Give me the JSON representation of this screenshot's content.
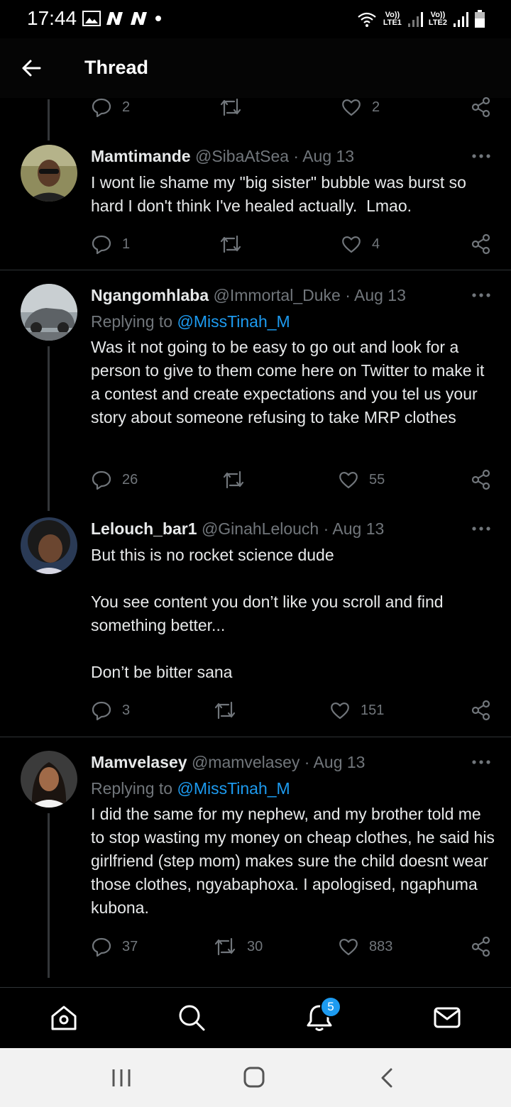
{
  "status_bar": {
    "time": "17:44",
    "lte1": "LTE1",
    "lte2": "LTE2",
    "volte1": "Vo))",
    "volte2": "Vo))"
  },
  "header": {
    "title": "Thread"
  },
  "top_tweet_actions": {
    "replies": "2",
    "retweets": "",
    "likes": "2"
  },
  "tweets": [
    {
      "name": "Mamtimande",
      "handle": "@SibaAtSea",
      "date": "· Aug 13",
      "replying_label": "",
      "replying_to": "",
      "text": "I wont lie shame my \"big sister\" bubble was burst so hard I don't think I've healed actually.  Lmao.",
      "replies": "1",
      "retweets": "",
      "likes": "4"
    },
    {
      "name": "Ngangomhlaba",
      "handle": "@Immortal_Duke",
      "date": "· Aug 13",
      "replying_label": "Replying to",
      "replying_to": "@MissTinah_M",
      "text": "Was it not going to be easy to go out and look for a person to give to them come here on Twitter to make it a contest and create expectations and you tel us your story about someone refusing to take MRP clothes",
      "replies": "26",
      "retweets": "",
      "likes": "55"
    },
    {
      "name": "Lelouch_bar1",
      "handle": "@GinahLelouch",
      "date": "· Aug 13",
      "replying_label": "",
      "replying_to": "",
      "text": "But this is no rocket science dude\n\nYou see content you don’t like you scroll and find something better...\n\nDon’t be bitter sana",
      "replies": "3",
      "retweets": "",
      "likes": "151"
    },
    {
      "name": "Mamvelasey",
      "handle": "@mamvelasey",
      "date": "· Aug 13",
      "replying_label": "Replying to",
      "replying_to": "@MissTinah_M",
      "text": "I did the same for my nephew, and my brother told me to stop wasting my money on cheap clothes, he said his girlfriend (step mom) makes sure the child doesnt wear those clothes, ngyabaphoxa. I apologised, ngaphuma kubona.",
      "replies": "37",
      "retweets": "30",
      "likes": "883"
    }
  ],
  "bottom_nav": {
    "notifications_badge": "5"
  },
  "icons": [
    "back-arrow-icon",
    "reply-icon",
    "retweet-icon",
    "like-icon",
    "share-icon",
    "more-icon",
    "home-icon",
    "search-icon",
    "bell-icon",
    "mail-icon"
  ],
  "colors": {
    "accent": "#1d9bf0",
    "background": "#000000",
    "muted": "#71767b"
  }
}
